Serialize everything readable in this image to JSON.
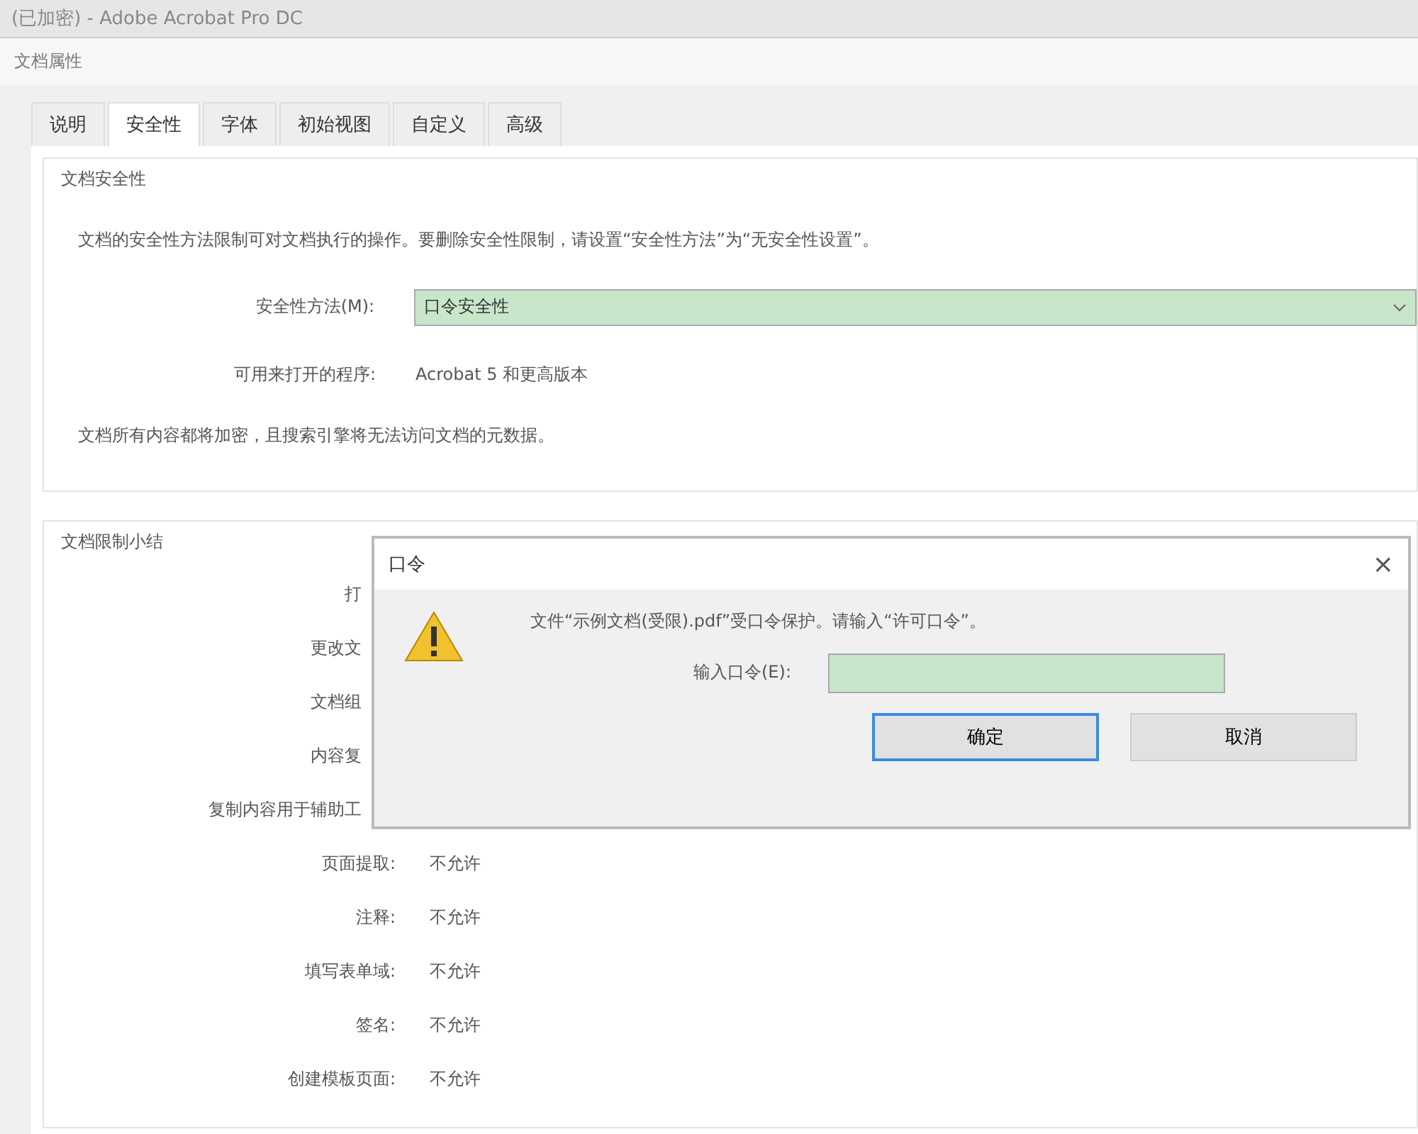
{
  "window": {
    "title": "(已加密) - Adobe Acrobat Pro DC",
    "dialog_title": "文档属性"
  },
  "tabs": [
    {
      "label": "说明",
      "selected": false
    },
    {
      "label": "安全性",
      "selected": true
    },
    {
      "label": "字体",
      "selected": false
    },
    {
      "label": "初始视图",
      "selected": false
    },
    {
      "label": "自定义",
      "selected": false
    },
    {
      "label": "高级",
      "selected": false
    }
  ],
  "security": {
    "heading": "文档安全性",
    "description": "文档的安全性方法限制可对文档执行的操作。要删除安全性限制，请设置“安全性方法”为“无安全性设置”。",
    "method_label": "安全性方法(M):",
    "method_value": "口令安全性",
    "programs_label": "可用来打开的程序:",
    "programs_value": "Acrobat 5 和更高版本",
    "note": "文档所有内容都将加密，且搜索引擎将无法访问文档的元数据。"
  },
  "restrictions": {
    "heading": "文档限制小结",
    "rows": [
      {
        "label": "打"
      },
      {
        "label": "更改文"
      },
      {
        "label": "文档组"
      },
      {
        "label": "内容复"
      },
      {
        "label": "复制内容用于辅助工"
      },
      {
        "label": "页面提取:",
        "value": "不允许"
      },
      {
        "label": "注释:",
        "value": "不允许"
      },
      {
        "label": "填写表单域:",
        "value": "不允许"
      },
      {
        "label": "签名:",
        "value": "不允许"
      },
      {
        "label": "创建模板页面:",
        "value": "不允许"
      }
    ]
  },
  "password_dialog": {
    "title": "口令",
    "close": "×",
    "message": "文件“示例文档(受限).pdf”受口令保护。请输入“许可口令”。",
    "field_label": "输入口令(E):",
    "buttons": [
      {
        "label": "确定",
        "selected": true
      },
      {
        "label": "取消",
        "selected": false
      }
    ]
  }
}
